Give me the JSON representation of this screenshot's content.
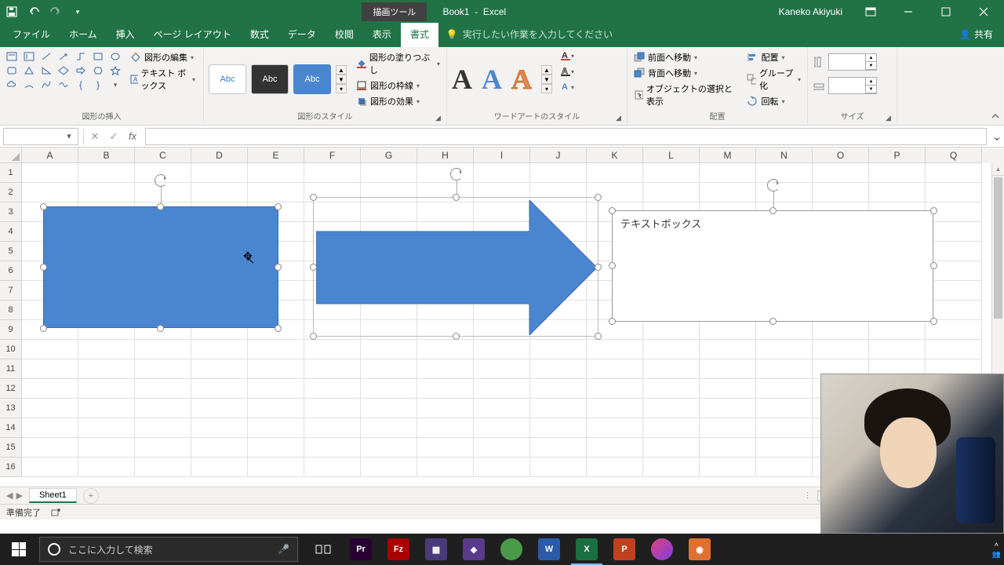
{
  "titlebar": {
    "tool_context": "描画ツール",
    "document": "Book1",
    "app": "Excel",
    "user": "Kaneko Akiyuki"
  },
  "tabs": {
    "file": "ファイル",
    "home": "ホーム",
    "insert": "挿入",
    "page_layout": "ページ レイアウト",
    "formulas": "数式",
    "data": "データ",
    "review": "校閲",
    "view": "表示",
    "format": "書式",
    "tell_me": "実行したい作業を入力してください",
    "share": "共有"
  },
  "ribbon": {
    "insert_shapes": {
      "label": "図形の挿入",
      "edit_shape": "図形の編集",
      "text_box": "テキスト ボックス"
    },
    "shape_styles": {
      "label": "図形のスタイル",
      "preset_text": "Abc",
      "fill": "図形の塗りつぶし",
      "outline": "図形の枠線",
      "effects": "図形の効果"
    },
    "wordart_styles": {
      "label": "ワードアートのスタイル",
      "glyph": "A"
    },
    "arrange": {
      "label": "配置",
      "bring_forward": "前面へ移動",
      "send_backward": "背面へ移動",
      "selection_pane": "オブジェクトの選択と表示",
      "align": "配置",
      "group": "グループ化",
      "rotate": "回転"
    },
    "size": {
      "label": "サイズ"
    }
  },
  "columns": [
    "A",
    "B",
    "C",
    "D",
    "E",
    "F",
    "G",
    "H",
    "I",
    "J",
    "K",
    "L",
    "M",
    "N",
    "O",
    "P",
    "Q"
  ],
  "row_count": 16,
  "shapes": {
    "textbox_content": "テキストボックス"
  },
  "sheet": {
    "name": "Sheet1"
  },
  "status": {
    "ready": "準備完了"
  },
  "taskbar": {
    "search_placeholder": "ここに入力して検索"
  }
}
